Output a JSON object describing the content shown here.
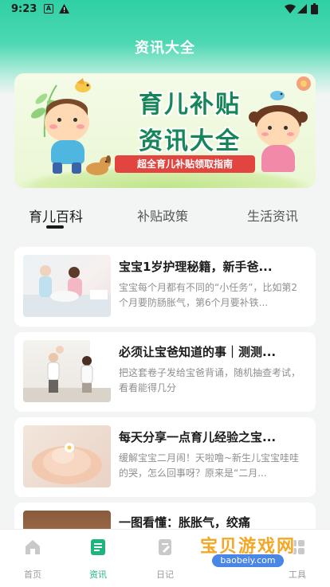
{
  "status_bar": {
    "time": "9:23"
  },
  "header": {
    "title": "资讯大全"
  },
  "banner": {
    "line1": "育儿补贴",
    "line2": "资讯大全",
    "tagline": "超全育儿补贴领取指南"
  },
  "tabs": [
    {
      "label": "育儿百科",
      "active": true
    },
    {
      "label": "补贴政策",
      "active": false
    },
    {
      "label": "生活资讯",
      "active": false
    }
  ],
  "articles": [
    {
      "title": "宝宝1岁护理秘籍，新手爸...",
      "desc": "宝宝每个月都有不同的“小任务”，比如第2个月要防肠胀气，第6个月要补铁..."
    },
    {
      "title": "必须让宝爸知道的事｜测测...",
      "desc": "把这套卷子发给宝爸背诵，随机抽查考试，看看能得几分"
    },
    {
      "title": "每天分享一点育儿经验之宝...",
      "desc": "缓解宝宝二月闹！天啦噜~新生儿宝宝哇哇的哭，怎么回事呀？原来是“二月..."
    },
    {
      "title": "一图看懂：胀胀气，绞痛",
      "desc": ""
    }
  ],
  "bottom_nav": [
    {
      "label": "首页",
      "icon": "home-icon",
      "active": false
    },
    {
      "label": "资讯",
      "icon": "news-icon",
      "active": true
    },
    {
      "label": "日记",
      "icon": "diary-icon",
      "active": false
    },
    {
      "label": "工具",
      "icon": "tools-icon",
      "active": false
    }
  ],
  "watermark": {
    "text": "宝贝游戏网",
    "sub": "baobeiy.com"
  },
  "colors": {
    "accent": "#1db57c",
    "header_gradient_top": "#2fd0a4",
    "banner_title": "#17855a",
    "banner_tag": "#e2453f"
  }
}
